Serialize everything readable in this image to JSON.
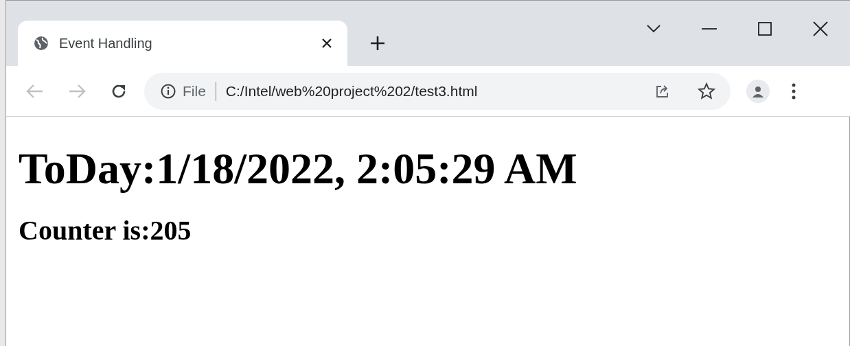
{
  "tab": {
    "title": "Event Handling",
    "selected": true
  },
  "omnibox": {
    "security_label": "File",
    "url": "C:/Intel/web%20project%202/test3.html"
  },
  "page": {
    "heading": "ToDay:1/18/2022, 2:05:29 AM",
    "counter": "Counter is:205"
  }
}
